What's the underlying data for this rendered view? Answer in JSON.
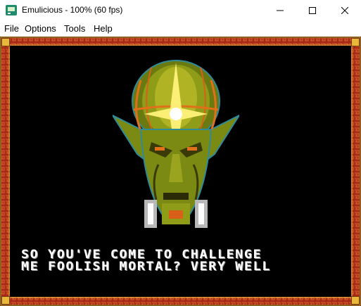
{
  "window": {
    "title": "Emulicious - 100% (60 fps)",
    "controls": [
      "minimize",
      "maximize",
      "close"
    ]
  },
  "menu": {
    "items": [
      "File",
      "Options",
      "Tools",
      "Help"
    ]
  },
  "game": {
    "dialog_line1": "SO YOU'VE COME TO CHALLENGE",
    "dialog_line2": "ME FOOLISH MORTAL? VERY WELL"
  },
  "colors": {
    "border_red": "#a8281a",
    "border_gold": "#e8b83a",
    "face_green": "#8a9a1a",
    "glow_yellow": "#fff27a"
  }
}
